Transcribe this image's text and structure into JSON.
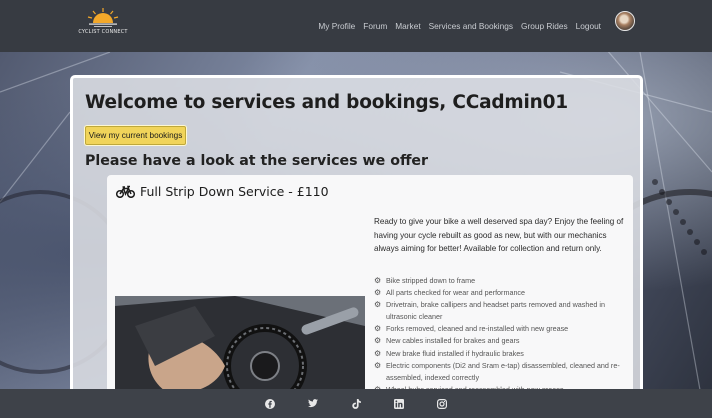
{
  "brand": {
    "logo_text": "CYCLIST CONNECT"
  },
  "nav": {
    "items": [
      {
        "label": "My Profile"
      },
      {
        "label": "Forum"
      },
      {
        "label": "Market"
      },
      {
        "label": "Services and Bookings"
      },
      {
        "label": "Group Rides"
      },
      {
        "label": "Logout"
      }
    ]
  },
  "main": {
    "title": "Welcome to services and bookings, CCadmin01",
    "bookings_button": "View my current bookings",
    "subtitle": "Please have a look at the services we offer"
  },
  "service": {
    "icon": "bicycle-icon",
    "title": "Full Strip Down Service - £110",
    "description": "Ready to give your bike a well deserved spa day? Enjoy the feeling of having your cycle rebuilt as good as new, but with our mechanics always aiming for better! Available for collection and return only.",
    "features": [
      "Bike stripped down to frame",
      "All parts checked for wear and performance",
      "Drivetrain, brake callipers and headset parts removed and washed in ultrasonic cleaner",
      "Forks removed, cleaned and re-installed with new grease",
      "New cables installed for brakes and gears",
      "New brake fluid installed if hydraulic brakes",
      "Electric components (Di2 and Sram e-tap) disassembled, cleaned and re-assembled, indexed correctly",
      "Wheel hubs serviced and reassembled with new grease"
    ]
  },
  "footer": {
    "socials": [
      "facebook-icon",
      "twitter-icon",
      "tiktok-icon",
      "linkedin-icon",
      "instagram-icon"
    ]
  },
  "colors": {
    "navbar": "#373b42",
    "accent_button": "#f1d45a",
    "footer": "#3e4249"
  }
}
